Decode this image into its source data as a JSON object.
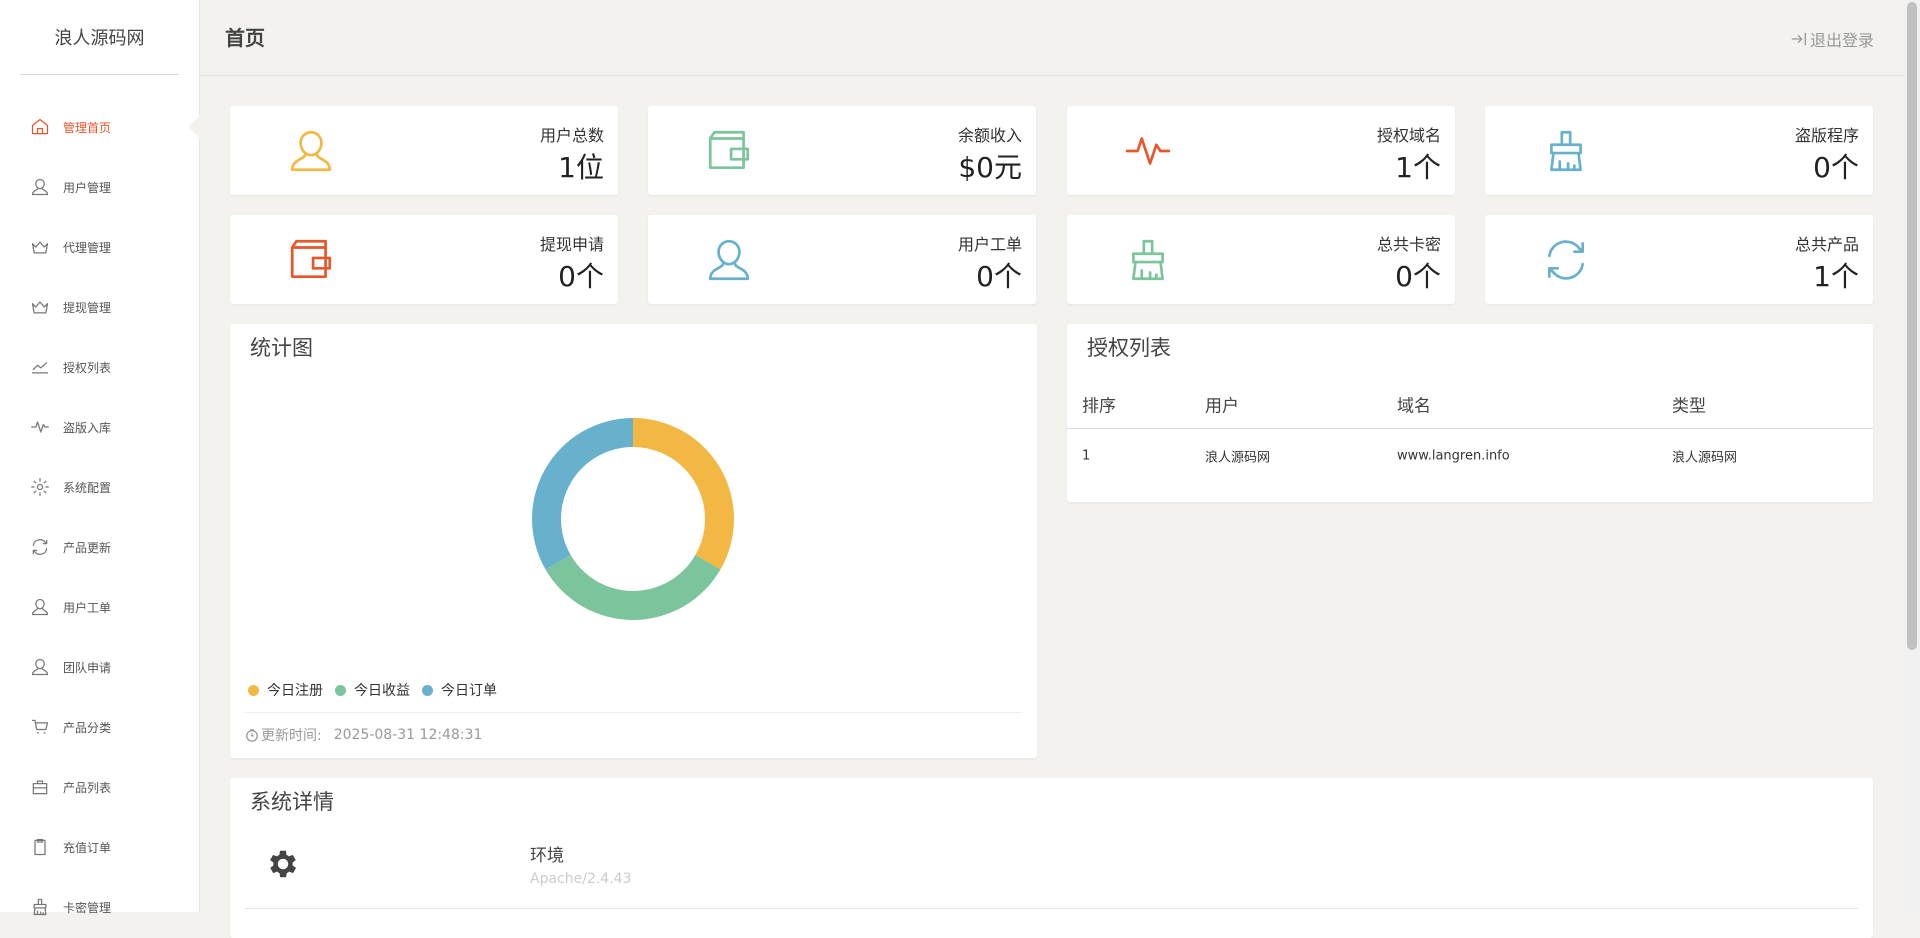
{
  "brand": "浪人源码网",
  "header": {
    "title": "首页",
    "logout": "退出登录"
  },
  "sidebar": {
    "items": [
      {
        "label": "管理首页",
        "icon": "home-icon"
      },
      {
        "label": "用户管理",
        "icon": "user-icon"
      },
      {
        "label": "代理管理",
        "icon": "crown-icon"
      },
      {
        "label": "提现管理",
        "icon": "crown-icon"
      },
      {
        "label": "授权列表",
        "icon": "trend-icon"
      },
      {
        "label": "盗版入库",
        "icon": "pulse-icon"
      },
      {
        "label": "系统配置",
        "icon": "gear-icon"
      },
      {
        "label": "产品更新",
        "icon": "refresh-icon"
      },
      {
        "label": "用户工单",
        "icon": "user-icon"
      },
      {
        "label": "团队申请",
        "icon": "user-icon"
      },
      {
        "label": "产品分类",
        "icon": "cart-icon"
      },
      {
        "label": "产品列表",
        "icon": "bag-icon"
      },
      {
        "label": "充值订单",
        "icon": "clipboard-icon"
      },
      {
        "label": "卡密管理",
        "icon": "brush-icon"
      }
    ]
  },
  "stats": [
    {
      "label": "用户总数",
      "value": "1位",
      "icon": "user-icon",
      "color": "#f2b843"
    },
    {
      "label": "余额收入",
      "value": "$0元",
      "icon": "wallet-icon",
      "color": "#7bc49c"
    },
    {
      "label": "授权域名",
      "value": "1个",
      "icon": "pulse-icon",
      "color": "#e8562b"
    },
    {
      "label": "盗版程序",
      "value": "0个",
      "icon": "brush-icon",
      "color": "#67b1cd"
    },
    {
      "label": "提现申请",
      "value": "0个",
      "icon": "wallet-icon",
      "color": "#e8562b"
    },
    {
      "label": "用户工单",
      "value": "0个",
      "icon": "user-icon",
      "color": "#67b1cd"
    },
    {
      "label": "总共卡密",
      "value": "0个",
      "icon": "brush-icon",
      "color": "#7bc49c"
    },
    {
      "label": "总共产品",
      "value": "1个",
      "icon": "refresh-icon",
      "color": "#67b1cd"
    }
  ],
  "chart_panel": {
    "title": "统计图",
    "update_label": "更新时间:",
    "update_time": "2025-08-31 12:48:31"
  },
  "chart_data": {
    "type": "pie",
    "categories": [
      "今日注册",
      "今日收益",
      "今日订单"
    ],
    "values": [
      1,
      1,
      1
    ],
    "colors": [
      "#f2b843",
      "#7bc49c",
      "#67b1cd"
    ],
    "legend_position": "bottom-left"
  },
  "auth_panel": {
    "title": "授权列表",
    "columns": [
      "排序",
      "用户",
      "域名",
      "类型"
    ],
    "rows": [
      [
        "1",
        "浪人源码网",
        "www.langren.info",
        "浪人源码网"
      ]
    ]
  },
  "system_panel": {
    "title": "系统详情",
    "env_label": "环境",
    "env_value": "Apache/2.4.43"
  }
}
